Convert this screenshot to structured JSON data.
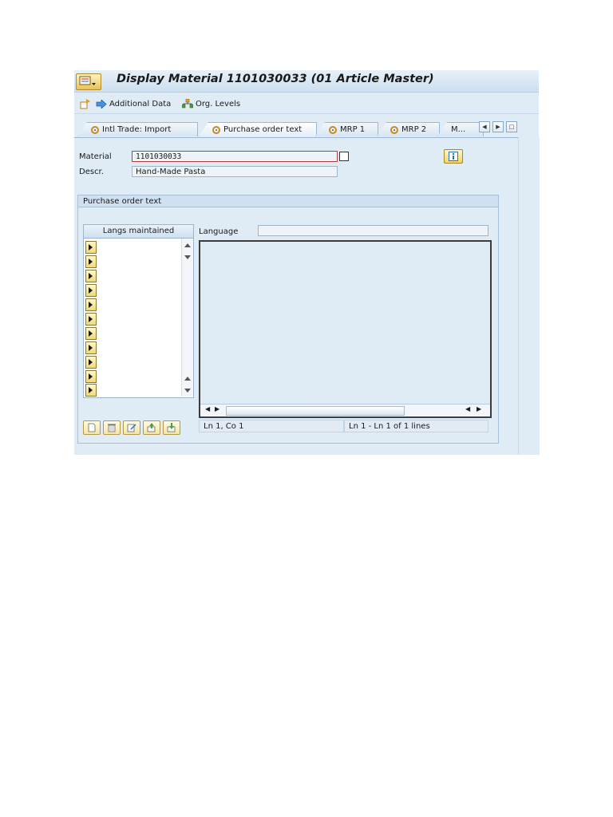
{
  "window": {
    "title": "Display Material 1101030033 (01 Article Master)"
  },
  "toolbar": {
    "additional_data": "Additional Data",
    "org_levels": "Org. Levels"
  },
  "tabs": [
    {
      "label": "Intl Trade: Import",
      "active": false
    },
    {
      "label": "Purchase order text",
      "active": true
    },
    {
      "label": "MRP 1",
      "active": false
    },
    {
      "label": "MRP 2",
      "active": false
    },
    {
      "label": "M...",
      "active": false
    }
  ],
  "header_fields": {
    "material_label": "Material",
    "material_value": "1101030033",
    "descr_label": "Descr.",
    "descr_value": "Hand-Made Pasta"
  },
  "group": {
    "title": "Purchase order text",
    "langs_header": "Langs maintained",
    "language_label": "Language",
    "language_value": "",
    "status_position": "Ln 1, Co 1",
    "status_lines": "Ln 1 - Ln 1 of 1 lines"
  },
  "colors": {
    "window_bg": "#dfebf5",
    "button_yellow": "#f0d56a",
    "accent_blue": "#2a6fc9"
  }
}
